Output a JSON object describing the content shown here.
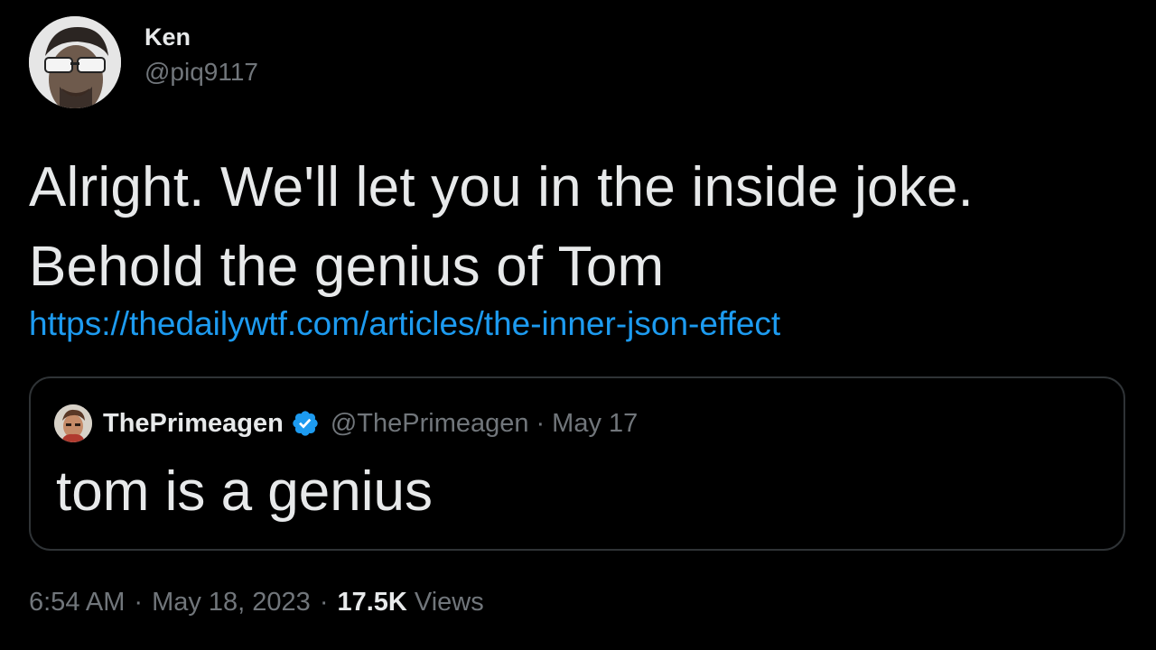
{
  "author": {
    "display_name": "Ken",
    "handle": "@piq9117"
  },
  "tweet": {
    "text": "Alright. We'll let you in the inside joke. Behold the genius of Tom",
    "link": "https://thedailywtf.com/articles/the-inner-json-effect"
  },
  "quoted_tweet": {
    "display_name": "ThePrimeagen",
    "handle": "@ThePrimeagen",
    "separator": "·",
    "date": "May 17",
    "text": "tom is a genius",
    "verified_icon": "verified-badge-icon"
  },
  "meta": {
    "time": "6:54 AM",
    "separator": "·",
    "date": "May 18, 2023",
    "views_count": "17.5K",
    "views_label": "Views"
  },
  "colors": {
    "background": "#000000",
    "text": "#e7e9ea",
    "secondary": "#71767b",
    "link": "#1d9bf0",
    "border": "#2f3336",
    "verified": "#1d9bf0"
  }
}
